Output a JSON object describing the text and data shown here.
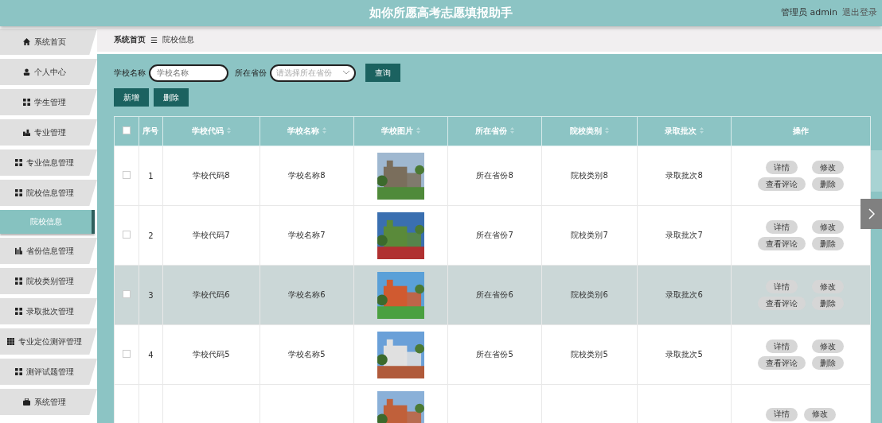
{
  "header": {
    "title": "如你所愿高考志愿填报助手",
    "user": "管理员 admin",
    "logout": "退出登录"
  },
  "sidebar": {
    "items": [
      {
        "label": "系统首页",
        "kind": "menu",
        "selected": false
      },
      {
        "label": "个人中心",
        "kind": "menu",
        "selected": false
      },
      {
        "label": "学生管理",
        "kind": "menu",
        "selected": false
      },
      {
        "label": "专业管理",
        "kind": "menu",
        "selected": false
      },
      {
        "label": "专业信息管理",
        "kind": "menu",
        "selected": false
      },
      {
        "label": "院校信息管理",
        "kind": "menu",
        "selected": false
      },
      {
        "label": "院校信息",
        "kind": "submenu",
        "selected": true
      },
      {
        "label": "省份信息管理",
        "kind": "menu",
        "selected": false
      },
      {
        "label": "院校类别管理",
        "kind": "menu",
        "selected": false
      },
      {
        "label": "录取批次管理",
        "kind": "menu",
        "selected": false
      },
      {
        "label": "专业定位测评管理",
        "kind": "menu",
        "selected": false
      },
      {
        "label": "测评试题管理",
        "kind": "menu",
        "selected": false
      },
      {
        "label": "系统管理",
        "kind": "menu",
        "selected": false
      }
    ]
  },
  "breadcrumb": {
    "home": "系统首页",
    "separator": "☰",
    "current": "院校信息"
  },
  "search": {
    "name_label": "学校名称",
    "name_placeholder": "学校名称",
    "province_label": "所在省份",
    "province_placeholder": "请选择所在省份",
    "query_button": "查询"
  },
  "actions": [
    "新增",
    "删除"
  ],
  "table": {
    "columns": [
      "序号",
      "学校代码",
      "学校名称",
      "学校图片",
      "所在省份",
      "院校类别",
      "录取批次",
      "操作"
    ],
    "rows": [
      {
        "index": "1",
        "code": "学校代码8",
        "name": "学校名称8",
        "province": "所在省份8",
        "category": "院校类别8",
        "batch": "录取批次8",
        "checked": false,
        "highlighted": false,
        "buttons": [
          "详情",
          "修改",
          "查看评论",
          "删除"
        ]
      },
      {
        "index": "2",
        "code": "学校代码7",
        "name": "学校名称7",
        "province": "所在省份7",
        "category": "院校类别7",
        "batch": "录取批次7",
        "checked": false,
        "highlighted": false,
        "buttons": [
          "详情",
          "修改",
          "查看评论",
          "删除"
        ]
      },
      {
        "index": "3",
        "code": "学校代码6",
        "name": "学校名称6",
        "province": "所在省份6",
        "category": "院校类别6",
        "batch": "录取批次6",
        "checked": false,
        "highlighted": true,
        "buttons": [
          "详情",
          "修改",
          "查看评论",
          "删除"
        ]
      },
      {
        "index": "4",
        "code": "学校代码5",
        "name": "学校名称5",
        "province": "所在省份5",
        "category": "院校类别5",
        "batch": "录取批次5",
        "checked": false,
        "highlighted": false,
        "buttons": [
          "详情",
          "修改",
          "查看评论",
          "删除"
        ]
      },
      {
        "highlighted": false,
        "buttons": [
          "详情",
          "修改"
        ]
      }
    ],
    "all_checked": false
  }
}
